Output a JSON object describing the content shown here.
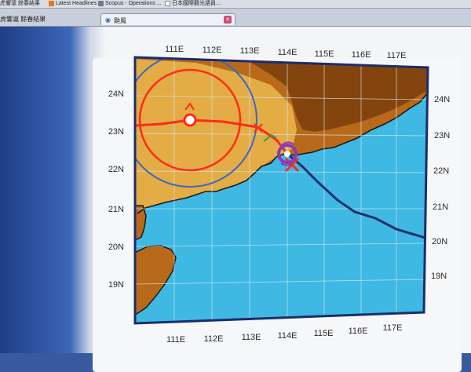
{
  "bookmarks": [
    {
      "label": "虎響滬 餘春結果",
      "icon": "bookmark-icon"
    },
    {
      "label": "Latest Headlines",
      "icon": "rss-icon"
    },
    {
      "label": "Scopus - Operations ...",
      "icon": "scopus-icon"
    },
    {
      "label": "日本國際觀光語員...",
      "icon": "document-icon"
    }
  ],
  "tabs": {
    "previous_label": "虎響滬 餘春結果",
    "active_label": "颱風",
    "active_icon": "globe-icon",
    "close_icon": "close-icon"
  },
  "map": {
    "top_lon_labels": [
      "111E",
      "112E",
      "113E",
      "114E",
      "115E",
      "116E",
      "117E"
    ],
    "bottom_lon_labels": [
      "111E",
      "112E",
      "113E",
      "114E",
      "115E",
      "116E",
      "117E"
    ],
    "left_lat_labels": [
      "24N",
      "23N",
      "22N",
      "21N",
      "20N",
      "19N"
    ],
    "right_lat_labels": [
      "24N",
      "23N",
      "22N",
      "21N",
      "20N",
      "19N"
    ],
    "colors": {
      "sea": "#3fb8e3",
      "land": "#b86a1a",
      "land_dark": "#7a3d0c",
      "forecast_cone": "#e8b44a",
      "forecast_track": "#ff2a1a",
      "past_track": "#1c2f6b",
      "gale_circle": "#ff2a1a",
      "storm_circle": "#3b67c8",
      "frame": "#1b2d6a"
    },
    "forecast_marker": "storm-center-icon",
    "current_marker": "typhoon-symbol-icon"
  }
}
